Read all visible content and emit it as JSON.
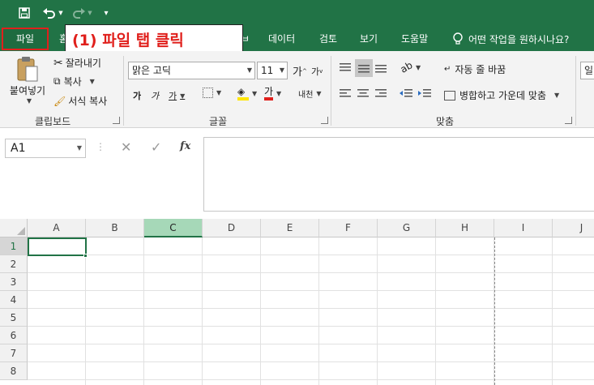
{
  "qat": {
    "customize": "▾"
  },
  "tabs": {
    "file": "파일",
    "hidden_home_fragment": "홈",
    "fragment_right": "ㅂ",
    "data": "데이터",
    "review": "검토",
    "view": "보기",
    "help": "도움말",
    "tell_me": "어떤 작업을 원하시나요?"
  },
  "annotation": "(1) 파일 탭 클릭",
  "ribbon": {
    "clipboard": {
      "paste": "붙여넣기",
      "cut": "잘라내기",
      "copy": "복사",
      "format_painter": "서식 복사",
      "label": "클립보드"
    },
    "font": {
      "font_name": "맑은 고딕",
      "font_size": "11",
      "grow": "가",
      "shrink": "가",
      "bold": "가",
      "italic": "가",
      "underline": "가",
      "font_color_glyph": "가",
      "phonetic": "내천",
      "label": "글꼴"
    },
    "alignment": {
      "wrap_text": "자동 줄 바꿈",
      "merge_center": "병합하고 가운데 맞춤",
      "label": "맞춤"
    },
    "number": {
      "format_fragment": "일"
    }
  },
  "formula_bar": {
    "name_box": "A1",
    "fx": "fx",
    "value": ""
  },
  "grid": {
    "columns": [
      "A",
      "B",
      "C",
      "D",
      "E",
      "F",
      "G",
      "H",
      "I",
      "J"
    ],
    "rows": [
      "1",
      "2",
      "3",
      "4",
      "5",
      "6",
      "7",
      "8"
    ],
    "selected_column": "C",
    "active_cell": "A1"
  },
  "colors": {
    "accent": "#217346",
    "annotation_red": "#e0201c"
  }
}
